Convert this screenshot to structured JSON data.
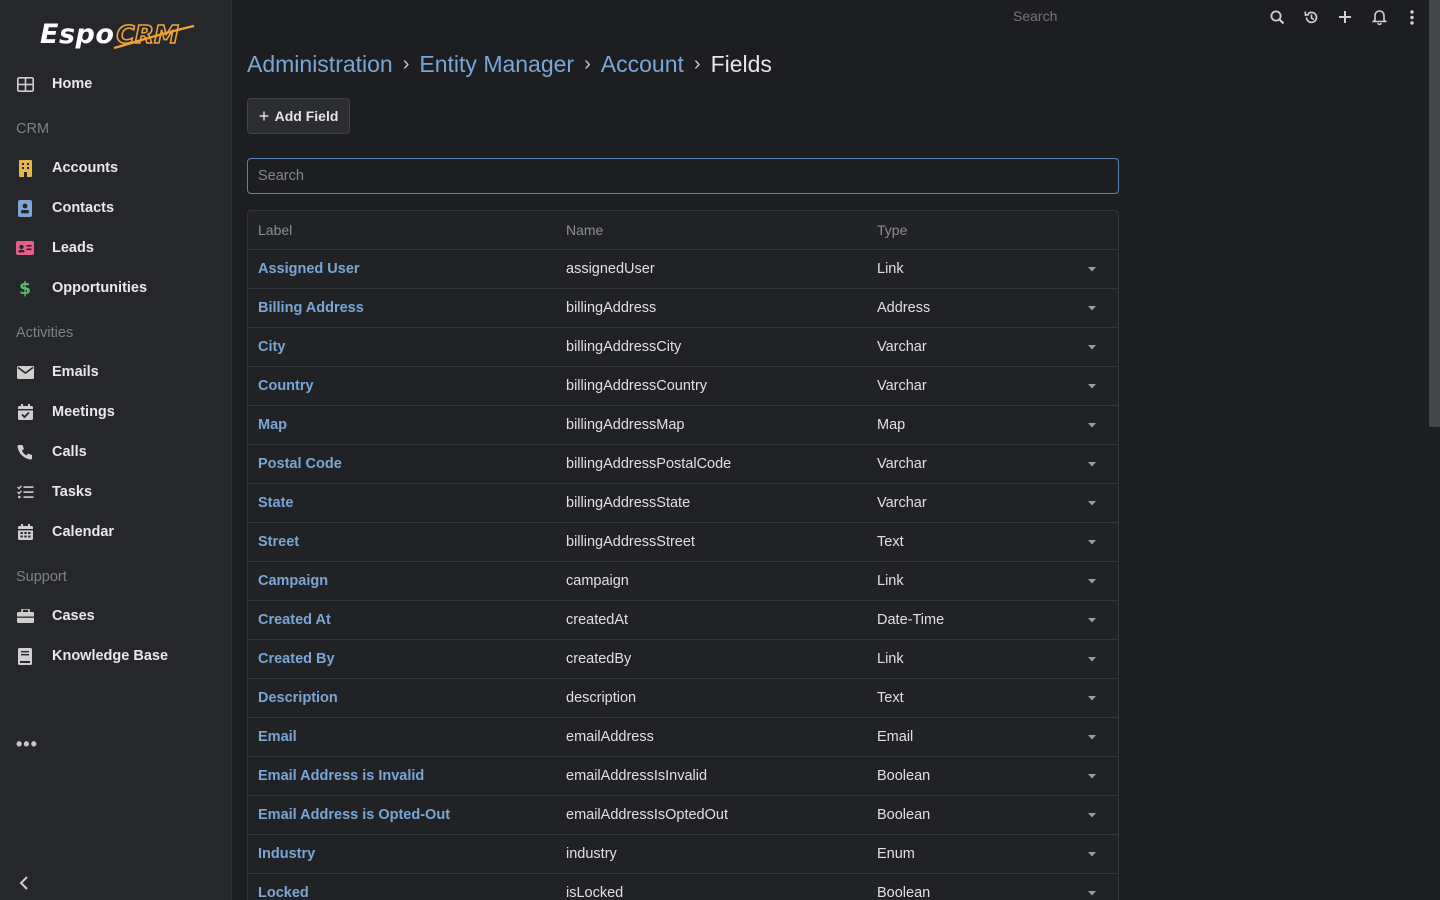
{
  "app": {
    "logo_main": "Espo",
    "logo_accent": "CRM"
  },
  "topbar": {
    "search_placeholder": "Search",
    "icons": [
      "search-icon",
      "history-icon",
      "plus-icon",
      "bell-icon",
      "kebab-menu-icon"
    ]
  },
  "sidebar": {
    "home": "Home",
    "group_crm": "CRM",
    "accounts": "Accounts",
    "contacts": "Contacts",
    "leads": "Leads",
    "opportunities": "Opportunities",
    "group_activities": "Activities",
    "emails": "Emails",
    "meetings": "Meetings",
    "calls": "Calls",
    "tasks": "Tasks",
    "calendar": "Calendar",
    "group_support": "Support",
    "cases": "Cases",
    "knowledge_base": "Knowledge Base",
    "more": "•••"
  },
  "breadcrumb": {
    "items": [
      "Administration",
      "Entity Manager",
      "Account"
    ],
    "current": "Fields",
    "separator": "›"
  },
  "toolbar": {
    "add_field_label": "Add Field"
  },
  "search": {
    "placeholder": "Search",
    "value": ""
  },
  "table": {
    "headers": {
      "label": "Label",
      "name": "Name",
      "type": "Type"
    },
    "rows": [
      {
        "label": "Assigned User",
        "name": "assignedUser",
        "type": "Link"
      },
      {
        "label": "Billing Address",
        "name": "billingAddress",
        "type": "Address"
      },
      {
        "label": "City",
        "name": "billingAddressCity",
        "type": "Varchar"
      },
      {
        "label": "Country",
        "name": "billingAddressCountry",
        "type": "Varchar"
      },
      {
        "label": "Map",
        "name": "billingAddressMap",
        "type": "Map"
      },
      {
        "label": "Postal Code",
        "name": "billingAddressPostalCode",
        "type": "Varchar"
      },
      {
        "label": "State",
        "name": "billingAddressState",
        "type": "Varchar"
      },
      {
        "label": "Street",
        "name": "billingAddressStreet",
        "type": "Text"
      },
      {
        "label": "Campaign",
        "name": "campaign",
        "type": "Link"
      },
      {
        "label": "Created At",
        "name": "createdAt",
        "type": "Date-Time"
      },
      {
        "label": "Created By",
        "name": "createdBy",
        "type": "Link"
      },
      {
        "label": "Description",
        "name": "description",
        "type": "Text"
      },
      {
        "label": "Email",
        "name": "emailAddress",
        "type": "Email"
      },
      {
        "label": "Email Address is Invalid",
        "name": "emailAddressIsInvalid",
        "type": "Boolean"
      },
      {
        "label": "Email Address is Opted-Out",
        "name": "emailAddressIsOptedOut",
        "type": "Boolean"
      },
      {
        "label": "Industry",
        "name": "industry",
        "type": "Enum"
      },
      {
        "label": "Locked",
        "name": "isLocked",
        "type": "Boolean"
      }
    ]
  },
  "colors": {
    "background": "#1d1e22",
    "sidebar": "#26272b",
    "link": "#7aa6d6",
    "accent": "#f0a23a"
  }
}
